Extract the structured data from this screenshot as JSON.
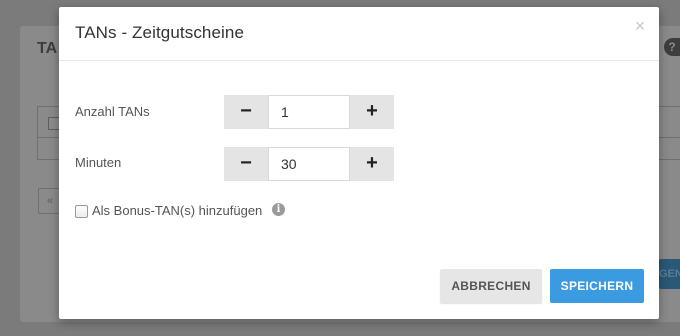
{
  "background": {
    "page_title": "TA",
    "help_icon": "?",
    "pager_first": "«",
    "right_button_label": "GEN"
  },
  "modal": {
    "title": "TANs - Zeitgutscheine",
    "close_glyph": "×",
    "fields": [
      {
        "label": "Anzahl TANs",
        "value": "1",
        "minus": "−",
        "plus": "+"
      },
      {
        "label": "Minuten",
        "value": "30",
        "minus": "−",
        "plus": "+"
      }
    ],
    "bonus": {
      "label": "Als Bonus-TAN(s) hinzufügen",
      "checked": false,
      "info_glyph": "i"
    },
    "buttons": {
      "cancel": "ABBRECHEN",
      "save": "SPEICHERN"
    }
  },
  "colors": {
    "primary": "#3a9be0",
    "secondary": "#e6e6e6",
    "backdrop": "#7b7b7b"
  },
  "icons": [
    "close-icon",
    "minus-icon",
    "plus-icon",
    "info-icon"
  ]
}
